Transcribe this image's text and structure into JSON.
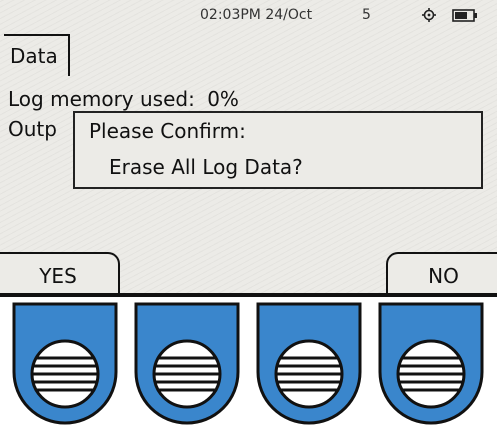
{
  "status_bar": {
    "time": "02:03PM 24/Oct",
    "signal": "5",
    "gps_icon": "crosshair-icon",
    "battery_icon": "battery-icon"
  },
  "menu": {
    "tab_label": "Data"
  },
  "content": {
    "log_memory_label": "Log memory used:",
    "log_memory_value": "0%",
    "output_partial": "Outp"
  },
  "dialog": {
    "title": "Please Confirm:",
    "message": "Erase All Log Data?"
  },
  "softkeys": {
    "left": "YES",
    "right": "NO"
  },
  "hardware": {
    "button_count": 4,
    "button_color": "#3a86cc",
    "icon": "grille-icon"
  },
  "colors": {
    "screen_bg": "#ecebe7",
    "ink": "#111111",
    "accent": "#3a86cc"
  }
}
